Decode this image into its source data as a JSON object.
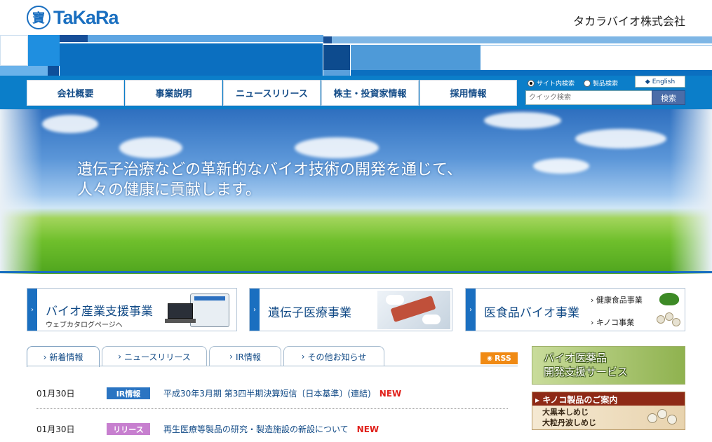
{
  "header": {
    "logo_mark": "寶",
    "logo_text": "TaKaRa",
    "company": "タカラバイオ株式会社"
  },
  "nav": [
    {
      "label": "会社概要"
    },
    {
      "label": "事業説明"
    },
    {
      "label": "ニュースリリース"
    },
    {
      "label": "株主・投資家情報"
    },
    {
      "label": "採用情報"
    }
  ],
  "search": {
    "scope_site": "サイト内検索",
    "scope_product": "製品検索",
    "english": "English",
    "placeholder": "クイック検索",
    "button": "検索"
  },
  "hero": {
    "line1": "遺伝子治療などの革新的なバイオ技術の開発を通じて、",
    "line2": "人々の健康に貢献します。"
  },
  "business": [
    {
      "title": "バイオ産業支援事業",
      "sub": "ウェブカタログページへ"
    },
    {
      "title": "遺伝子医療事業"
    },
    {
      "title": "医食品バイオ事業",
      "links": [
        "健康食品事業",
        "キノコ事業"
      ]
    }
  ],
  "tabs": [
    {
      "label": "新着情報"
    },
    {
      "label": "ニュースリリース"
    },
    {
      "label": "IR情報"
    },
    {
      "label": "その他お知らせ"
    }
  ],
  "rss": "RSS",
  "news": [
    {
      "date": "01月30日",
      "category": "IR情報",
      "text": "平成30年3月期 第3四半期決算短信〔日本基準〕(連結)",
      "badge": "NEW"
    },
    {
      "date": "01月30日",
      "category": "リリース",
      "text": "再生医療等製品の研究・製造施設の新設について",
      "badge": "NEW"
    }
  ],
  "banners": {
    "bio_drug": "バイオ医薬品\n開発支援サービス",
    "kinoko_title": "キノコ製品のご案内",
    "kinoko_line1": "大黒本しめじ",
    "kinoko_line2": "大粒丹波しめじ"
  },
  "colors": {
    "brand_blue": "#1a6fc0",
    "nav_blue": "#0b7ec9",
    "ir_badge": "#2a74c2",
    "release_badge": "#c77fcf",
    "new_red": "#e0201a",
    "rss_orange": "#f08a14"
  }
}
